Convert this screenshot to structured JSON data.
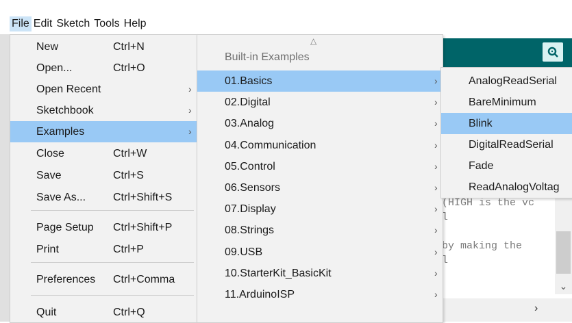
{
  "menubar": [
    "File",
    "Edit",
    "Sketch",
    "Tools",
    "Help"
  ],
  "file_menu": [
    {
      "label": "New",
      "shortcut": "Ctrl+N",
      "arrow": false
    },
    {
      "label": "Open...",
      "shortcut": "Ctrl+O",
      "arrow": false
    },
    {
      "label": "Open Recent",
      "shortcut": "",
      "arrow": true
    },
    {
      "label": "Sketchbook",
      "shortcut": "",
      "arrow": true
    },
    {
      "label": "Examples",
      "shortcut": "",
      "arrow": true,
      "selected": true
    },
    {
      "label": "Close",
      "shortcut": "Ctrl+W",
      "arrow": false
    },
    {
      "label": "Save",
      "shortcut": "Ctrl+S",
      "arrow": false
    },
    {
      "label": "Save As...",
      "shortcut": "Ctrl+Shift+S",
      "arrow": false
    },
    {
      "label": "Page Setup",
      "shortcut": "Ctrl+Shift+P",
      "arrow": false
    },
    {
      "label": "Print",
      "shortcut": "Ctrl+P",
      "arrow": false
    },
    {
      "label": "Preferences",
      "shortcut": "Ctrl+Comma",
      "arrow": false
    },
    {
      "label": "Quit",
      "shortcut": "Ctrl+Q",
      "arrow": false
    }
  ],
  "examples_menu": {
    "scroll_up": "△",
    "header": "Built-in Examples",
    "items": [
      {
        "label": "01.Basics",
        "selected": true
      },
      {
        "label": "02.Digital"
      },
      {
        "label": "03.Analog"
      },
      {
        "label": "04.Communication"
      },
      {
        "label": "05.Control"
      },
      {
        "label": "06.Sensors"
      },
      {
        "label": "07.Display"
      },
      {
        "label": "08.Strings"
      },
      {
        "label": "09.USB"
      },
      {
        "label": "10.StarterKit_BasicKit"
      },
      {
        "label": "11.ArduinoISP"
      }
    ]
  },
  "basics_menu": [
    {
      "label": "AnalogReadSerial"
    },
    {
      "label": "BareMinimum"
    },
    {
      "label": "Blink",
      "selected": true
    },
    {
      "label": "DigitalReadSerial"
    },
    {
      "label": "Fade"
    },
    {
      "label": "ReadAnalogVoltag"
    }
  ],
  "editor": {
    "serial_icon": "magnifier-icon",
    "code_lines": [
      "(HIGH is the vc",
      "l",
      "",
      "by making the",
      "l"
    ]
  },
  "arrow_glyph": "›",
  "colors": {
    "highlight": "#99c9f5",
    "teal": "#006468",
    "menu_bg": "#f2f2f2"
  }
}
